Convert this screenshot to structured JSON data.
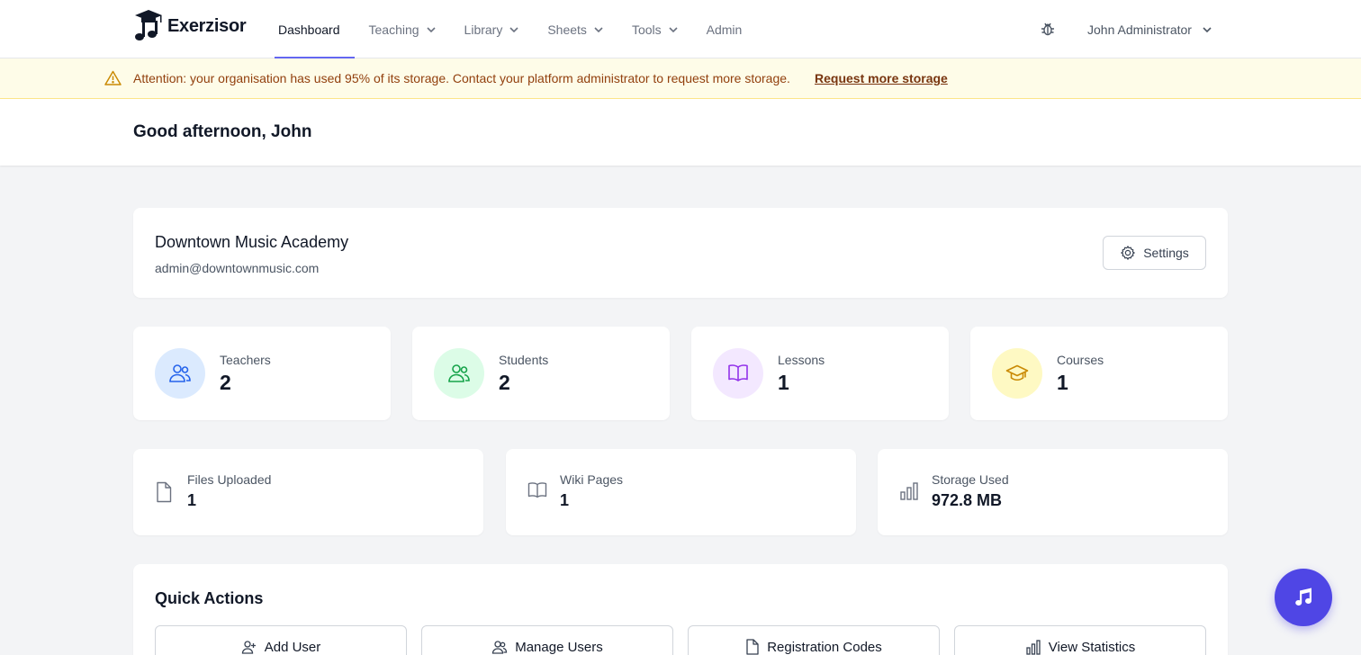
{
  "app": {
    "name": "Exerzisor"
  },
  "nav": {
    "items": [
      {
        "label": "Dashboard",
        "active": true
      },
      {
        "label": "Teaching",
        "dropdown": true
      },
      {
        "label": "Library",
        "dropdown": true
      },
      {
        "label": "Sheets",
        "dropdown": true
      },
      {
        "label": "Tools",
        "dropdown": true
      },
      {
        "label": "Admin"
      }
    ],
    "user_name": "John Administrator"
  },
  "alert": {
    "message": "Attention: your organisation has used 95% of its storage. Contact your platform administrator to request more storage.",
    "link": "Request more storage"
  },
  "greeting": "Good afternoon, John",
  "organisation": {
    "name": "Downtown Music Academy",
    "email": "admin@downtownmusic.com",
    "settings_label": "Settings"
  },
  "stats": [
    {
      "label": "Teachers",
      "value": "2",
      "icon": "users-icon",
      "color": "#2563eb",
      "bg": "#dbeafe"
    },
    {
      "label": "Students",
      "value": "2",
      "icon": "users-icon",
      "color": "#16a34a",
      "bg": "#dcfce7"
    },
    {
      "label": "Lessons",
      "value": "1",
      "icon": "book-open-icon",
      "color": "#9333ea",
      "bg": "#f3e8ff"
    },
    {
      "label": "Courses",
      "value": "1",
      "icon": "graduation-cap-icon",
      "color": "#ca8a04",
      "bg": "#fef9c3"
    }
  ],
  "secondary_stats": [
    {
      "label": "Files Uploaded",
      "value": "1",
      "icon": "document-icon"
    },
    {
      "label": "Wiki Pages",
      "value": "1",
      "icon": "book-icon"
    },
    {
      "label": "Storage Used",
      "value": "972.8 MB",
      "icon": "bar-chart-icon"
    }
  ],
  "quick_actions": {
    "title": "Quick Actions",
    "buttons": [
      {
        "label": "Add User",
        "icon": "user-plus-icon"
      },
      {
        "label": "Manage Users",
        "icon": "users-icon"
      },
      {
        "label": "Registration Codes",
        "icon": "document-icon"
      },
      {
        "label": "View Statistics",
        "icon": "bar-chart-icon"
      }
    ]
  },
  "colors": {
    "accent": "#6366f1",
    "fab": "#4f46e5",
    "alert_bg": "#fefce8",
    "alert_text": "#92400e"
  }
}
